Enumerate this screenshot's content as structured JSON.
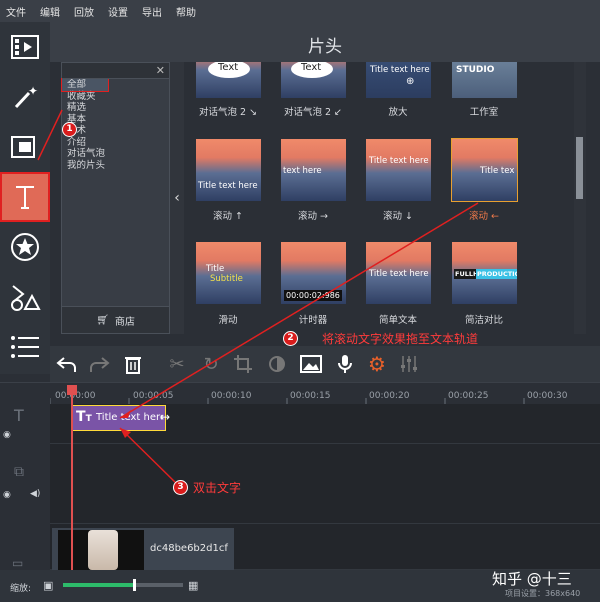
{
  "menu": [
    "文件",
    "编辑",
    "回放",
    "设置",
    "导出",
    "帮助"
  ],
  "panel": {
    "title": "片头"
  },
  "categories": [
    "全部",
    "收藏夹",
    "精选",
    "基本",
    "艺术",
    "介绍",
    "对话气泡",
    "我的片头"
  ],
  "store_label": "商店",
  "tiles": [
    {
      "label": "对话气泡 2 ↘",
      "text": "Text"
    },
    {
      "label": "对话气泡 2 ↙",
      "text": "Text"
    },
    {
      "label": "放大",
      "text": "Title text here"
    },
    {
      "label": "工作室",
      "text": "STUDIO"
    },
    {
      "label": "滚动 ↑",
      "text": "Title text here"
    },
    {
      "label": "滚动 →",
      "text": "text here"
    },
    {
      "label": "滚动 ↓",
      "text": "Title text here"
    },
    {
      "label": "滚动 ←",
      "text": "Title tex"
    },
    {
      "label": "滑动",
      "text": "Title",
      "sub": "Subtitle"
    },
    {
      "label": "计时器",
      "text": "00:00:02:986"
    },
    {
      "label": "简单文本",
      "text": "Title text here"
    },
    {
      "label": "简洁对比",
      "text": "FULLHD",
      "text2": "PRODUCTION"
    }
  ],
  "annotations": {
    "a2": "将滚动文字效果拖至文本轨道",
    "a3": "双击文字",
    "n1": "1",
    "n2": "2",
    "n3": "3"
  },
  "ruler": [
    "00:00:00",
    "00:00:05",
    "00:00:10",
    "00:00:15",
    "00:00:20",
    "00:00:25",
    "00:00:30"
  ],
  "timeline": {
    "text_clip": "Title text here",
    "video_clip": "dc48be6b2d1cf"
  },
  "status": {
    "zoom_label": "缩放:",
    "watermark": "知乎 @十三",
    "project_settings": "项目设置：368x640"
  }
}
